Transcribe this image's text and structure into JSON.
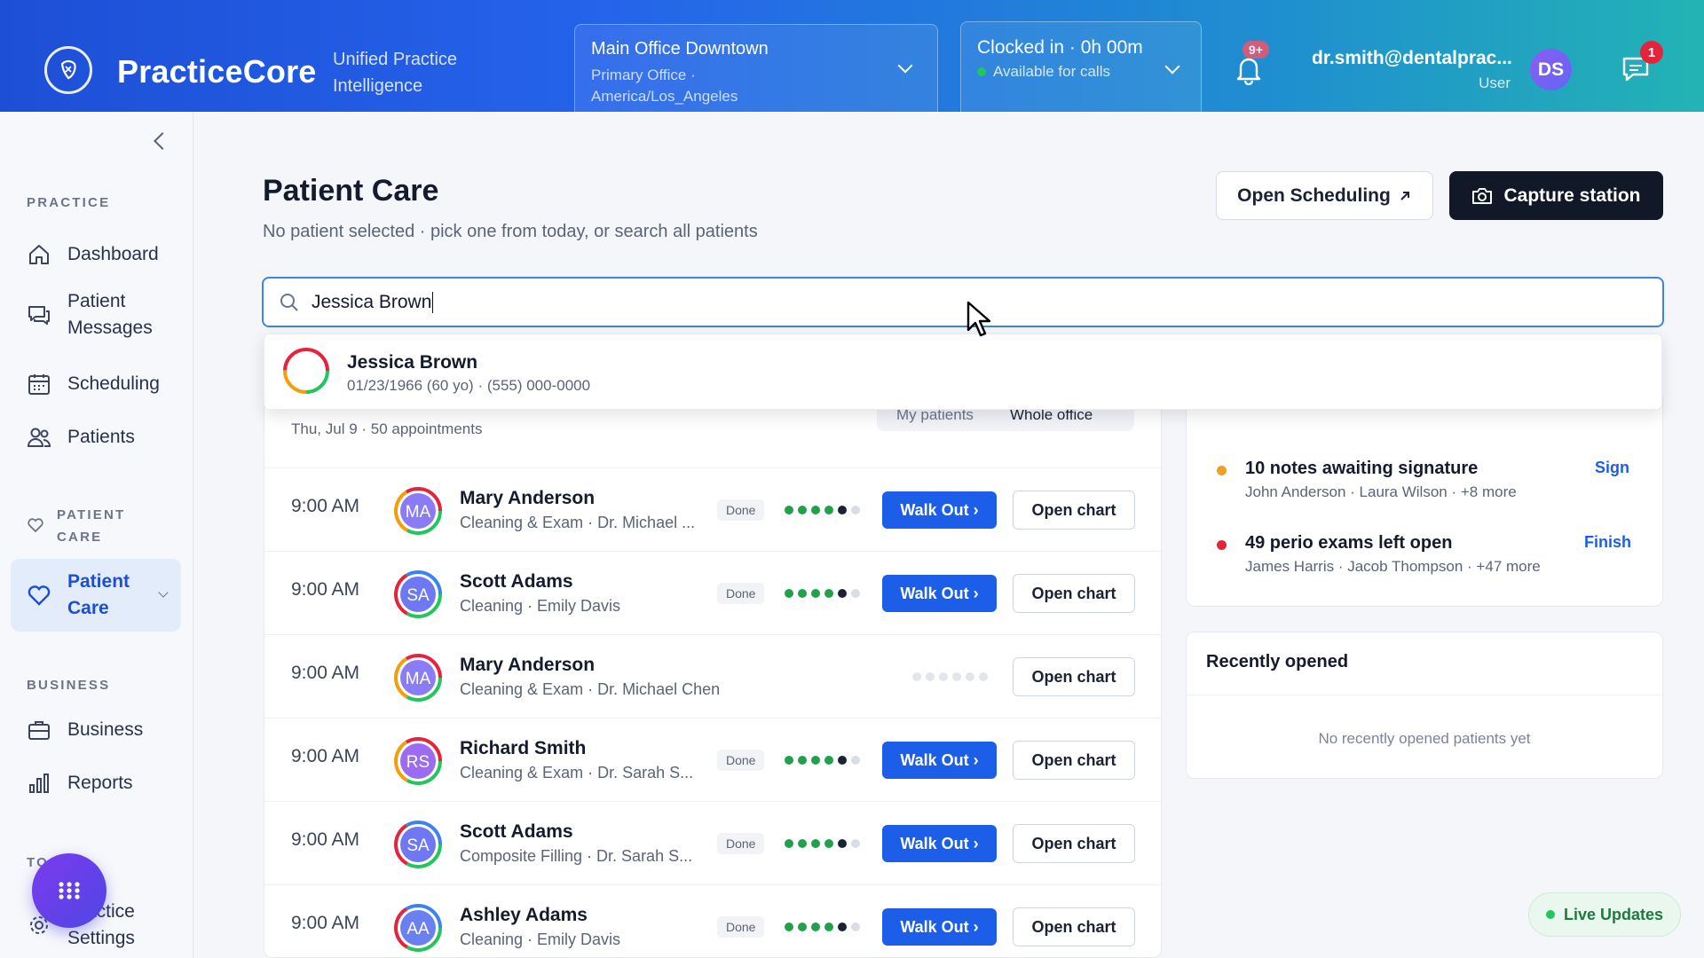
{
  "header": {
    "brand": "PracticeCore",
    "tagline": "Unified Practice Intelligence",
    "office": {
      "name": "Main Office Downtown",
      "detail": "Primary Office · America/Los_Angeles"
    },
    "clock": {
      "status": "Clocked in · 0h 00m",
      "availability": "Available for calls"
    },
    "notifications_badge": "9+",
    "user": {
      "email": "dr.smith@dentalprac...",
      "role": "User",
      "initials": "DS"
    },
    "messages_badge": "1"
  },
  "sidebar": {
    "sections": {
      "practice": "PRACTICE",
      "patient_care": "PATIENT CARE",
      "business": "BUSINESS",
      "tools": "TO"
    },
    "items": {
      "dashboard": "Dashboard",
      "patient_messages": "Patient Messages",
      "scheduling": "Scheduling",
      "patients": "Patients",
      "patient_care": "Patient Care",
      "business": "Business",
      "reports": "Reports",
      "practice_settings": "Practice Settings"
    }
  },
  "main": {
    "title": "Patient Care",
    "subtitle": "No patient selected · pick one from today, or search all patients",
    "open_scheduling": "Open Scheduling",
    "capture_station": "Capture station",
    "search_value": "Jessica Brown",
    "result": {
      "name": "Jessica Brown",
      "meta": "01/23/1966 (60 yo) · (555) 000-0000"
    },
    "schedule": {
      "date": "Thu, Jul 9 · 50 appointments",
      "toggle": [
        "My patients",
        "Whole office"
      ],
      "rows": [
        {
          "time": "9:00 AM",
          "initials": "MA",
          "name": "Mary Anderson",
          "desc": "Cleaning & Exam · Dr. Michael ...",
          "status": "Done",
          "walk": "Walk Out ›",
          "chart": "Open chart"
        },
        {
          "time": "9:00 AM",
          "initials": "SA",
          "name": "Scott Adams",
          "desc": "Cleaning · Emily Davis",
          "status": "Done",
          "walk": "Walk Out ›",
          "chart": "Open chart"
        },
        {
          "time": "9:00 AM",
          "initials": "MA",
          "name": "Mary Anderson",
          "desc": "Cleaning & Exam · Dr. Michael Chen",
          "status": "",
          "walk": "",
          "chart": "Open chart"
        },
        {
          "time": "9:00 AM",
          "initials": "RS",
          "name": "Richard Smith",
          "desc": "Cleaning & Exam · Dr. Sarah S...",
          "status": "Done",
          "walk": "Walk Out ›",
          "chart": "Open chart"
        },
        {
          "time": "9:00 AM",
          "initials": "SA",
          "name": "Scott Adams",
          "desc": "Composite Filling · Dr. Sarah S...",
          "status": "Done",
          "walk": "Walk Out ›",
          "chart": "Open chart"
        },
        {
          "time": "9:00 AM",
          "initials": "AA",
          "name": "Ashley Adams",
          "desc": "Cleaning · Emily Davis",
          "status": "Done",
          "walk": "Walk Out ›",
          "chart": "Open chart"
        }
      ]
    },
    "tasks": [
      {
        "title": "10 notes awaiting signature",
        "sub": "John Anderson · Laura Wilson · +8 more",
        "action": "Sign",
        "color": "#f0a020"
      },
      {
        "title": "49 perio exams left open",
        "sub": "James Harris · Jacob Thompson · +47 more",
        "action": "Finish",
        "color": "#e5233b"
      }
    ],
    "recent": {
      "title": "Recently opened",
      "empty": "No recently opened patients yet"
    },
    "live": "Live Updates"
  }
}
